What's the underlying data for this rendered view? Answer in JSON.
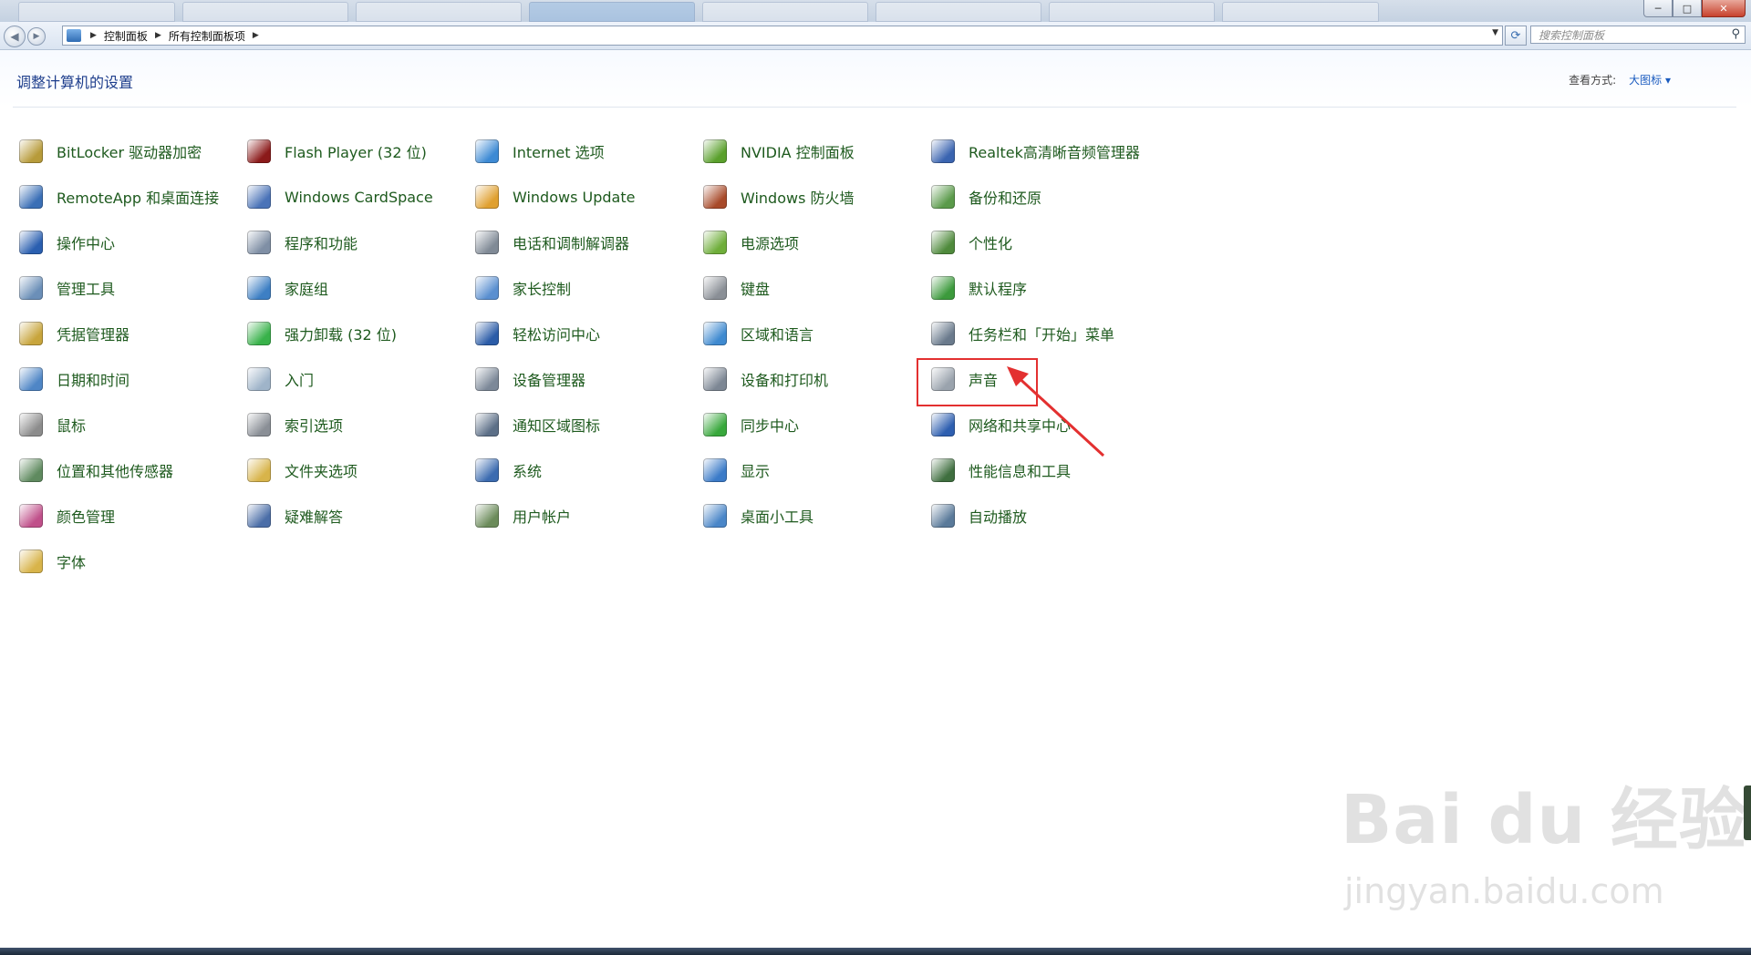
{
  "address_bar": {
    "crumbs": [
      "控制面板",
      "所有控制面板项"
    ],
    "search_placeholder": "搜索控制面板"
  },
  "window_controls": {
    "minimize": "─",
    "maximize": "□",
    "close": "✕"
  },
  "header": {
    "title": "调整计算机的设置",
    "view_by_label": "查看方式:",
    "view_by_value": "大图标 ▾"
  },
  "items": [
    [
      {
        "label": "BitLocker 驱动器加密",
        "icon": "key-drive-icon",
        "color": "#b79b3a"
      },
      {
        "label": "RemoteApp 和桌面连接",
        "icon": "remote-desktop-icon",
        "color": "#3a6fb6"
      },
      {
        "label": "操作中心",
        "icon": "flag-icon",
        "color": "#2a5fb0"
      },
      {
        "label": "管理工具",
        "icon": "admin-tools-icon",
        "color": "#6b8fb8"
      },
      {
        "label": "凭据管理器",
        "icon": "vault-icon",
        "color": "#c8a53c"
      },
      {
        "label": "日期和时间",
        "icon": "calendar-clock-icon",
        "color": "#4f86c6"
      },
      {
        "label": "鼠标",
        "icon": "mouse-icon",
        "color": "#8c8c8c"
      },
      {
        "label": "位置和其他传感器",
        "icon": "sensor-icon",
        "color": "#5f8a5f"
      },
      {
        "label": "颜色管理",
        "icon": "color-management-icon",
        "color": "#c0508a"
      },
      {
        "label": "字体",
        "icon": "font-folder-icon",
        "color": "#d8b44a"
      }
    ],
    [
      {
        "label": "Flash Player (32 位)",
        "icon": "flash-icon",
        "color": "#8b1a1a"
      },
      {
        "label": "Windows CardSpace",
        "icon": "cardspace-icon",
        "color": "#4a73b8"
      },
      {
        "label": "程序和功能",
        "icon": "programs-icon",
        "color": "#7f8fa5"
      },
      {
        "label": "家庭组",
        "icon": "homegroup-icon",
        "color": "#3d7fc4"
      },
      {
        "label": "强力卸载 (32 位)",
        "icon": "uninstall-icon",
        "color": "#38b24a"
      },
      {
        "label": "入门",
        "icon": "getting-started-icon",
        "color": "#9fb4c9"
      },
      {
        "label": "索引选项",
        "icon": "index-magnifier-icon",
        "color": "#8a8f96"
      },
      {
        "label": "文件夹选项",
        "icon": "folder-options-icon",
        "color": "#d8b44a"
      },
      {
        "label": "疑难解答",
        "icon": "troubleshoot-icon",
        "color": "#4b6ea8"
      }
    ],
    [
      {
        "label": "Internet 选项",
        "icon": "globe-icon",
        "color": "#3d8ad4"
      },
      {
        "label": "Windows Update",
        "icon": "windows-update-icon",
        "color": "#e0a030"
      },
      {
        "label": "电话和调制解调器",
        "icon": "phone-modem-icon",
        "color": "#808a96"
      },
      {
        "label": "家长控制",
        "icon": "parental-control-icon",
        "color": "#5a8fd0"
      },
      {
        "label": "轻松访问中心",
        "icon": "ease-of-access-icon",
        "color": "#2b5ca8"
      },
      {
        "label": "设备管理器",
        "icon": "device-manager-icon",
        "color": "#7c8898"
      },
      {
        "label": "通知区域图标",
        "icon": "notification-icon",
        "color": "#5c6f87"
      },
      {
        "label": "系统",
        "icon": "system-icon",
        "color": "#3b6bb0"
      },
      {
        "label": "用户帐户",
        "icon": "user-accounts-icon",
        "color": "#6b8b5a"
      }
    ],
    [
      {
        "label": "NVIDIA 控制面板",
        "icon": "nvidia-icon",
        "color": "#5aa02c"
      },
      {
        "label": "Windows 防火墙",
        "icon": "firewall-icon",
        "color": "#a84a2a"
      },
      {
        "label": "电源选项",
        "icon": "power-icon",
        "color": "#6fae3a"
      },
      {
        "label": "键盘",
        "icon": "keyboard-icon",
        "color": "#8a8f96"
      },
      {
        "label": "区域和语言",
        "icon": "region-globe-icon",
        "color": "#3f8ad0"
      },
      {
        "label": "设备和打印机",
        "icon": "printer-icon",
        "color": "#7d8794"
      },
      {
        "label": "同步中心",
        "icon": "sync-icon",
        "color": "#38a83c"
      },
      {
        "label": "显示",
        "icon": "display-icon",
        "color": "#3b7bc8"
      },
      {
        "label": "桌面小工具",
        "icon": "gadgets-icon",
        "color": "#4a86c8"
      }
    ],
    [
      {
        "label": "Realtek高清晰音频管理器",
        "icon": "realtek-audio-icon",
        "color": "#3a64b0"
      },
      {
        "label": "备份和还原",
        "icon": "backup-icon",
        "color": "#5a9a4a"
      },
      {
        "label": "个性化",
        "icon": "personalization-icon",
        "color": "#4f8a3c"
      },
      {
        "label": "默认程序",
        "icon": "default-programs-icon",
        "color": "#3c9a3c"
      },
      {
        "label": "任务栏和「开始」菜单",
        "icon": "taskbar-icon",
        "color": "#6a7a8c"
      },
      {
        "label": "声音",
        "icon": "speaker-icon",
        "color": "#9aa3ad"
      },
      {
        "label": "网络和共享中心",
        "icon": "network-icon",
        "color": "#2e5fb0"
      },
      {
        "label": "性能信息和工具",
        "icon": "performance-icon",
        "color": "#3f6f3f"
      },
      {
        "label": "自动播放",
        "icon": "autoplay-icon",
        "color": "#5a7a9a"
      }
    ]
  ],
  "watermark": {
    "brand": "Bai du 经验",
    "url": "jingyan.baidu.com"
  }
}
